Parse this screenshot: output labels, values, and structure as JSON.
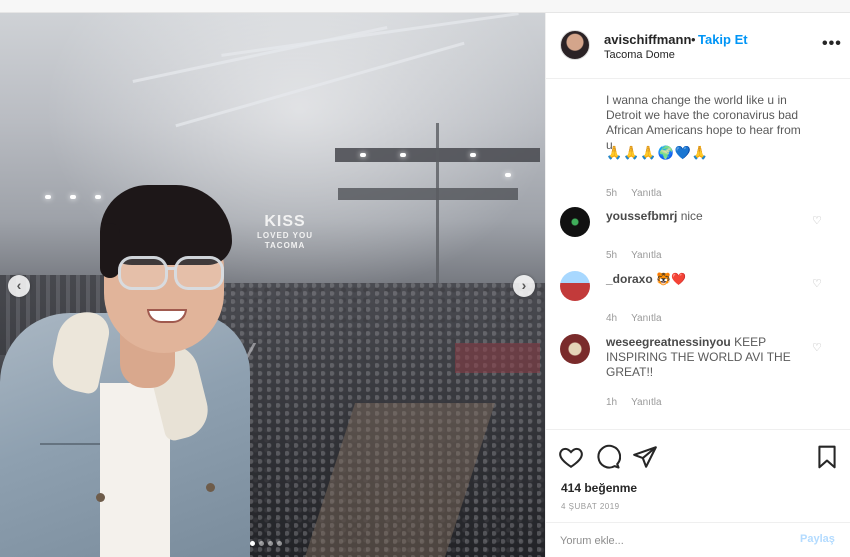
{
  "post": {
    "username": "avischiffmann",
    "separator": "•",
    "follow_label": "Takip Et",
    "location": "Tacoma Dome",
    "more_label": "•••"
  },
  "photo": {
    "sign_line1": "KISS",
    "sign_line2": "LOVED YOU",
    "sign_line3": "TACOMA",
    "prev_arrow": "‹",
    "next_arrow": "›"
  },
  "comments": [
    {
      "text": "I wanna change the world like u in Detroit we have the coronavirus bad African Americans hope to hear from u",
      "emoji": "🙏🙏🙏🌍💙🙏",
      "time": "5h",
      "reply": "Yanıtla"
    },
    {
      "user": "youssefbmrj",
      "text": "nice",
      "time": "5h",
      "reply": "Yanıtla"
    },
    {
      "user": "_doraxo",
      "text": "🐯❤️",
      "time": "4h",
      "reply": "Yanıtla"
    },
    {
      "user": "weseegreatnessinyou",
      "text": "KEEP INSPIRING THE WORLD AVI THE GREAT!!",
      "time": "1h",
      "reply": "Yanıtla"
    }
  ],
  "actions": {
    "like_icon": "heart-outline-icon",
    "comment_icon": "comment-bubble-icon",
    "share_icon": "paper-plane-icon",
    "save_icon": "bookmark-icon",
    "likes": "414 beğenme",
    "date": "4 ŞUBAT 2019"
  },
  "comment_box": {
    "placeholder": "Yorum ekle...",
    "share_label": "Paylaş"
  }
}
